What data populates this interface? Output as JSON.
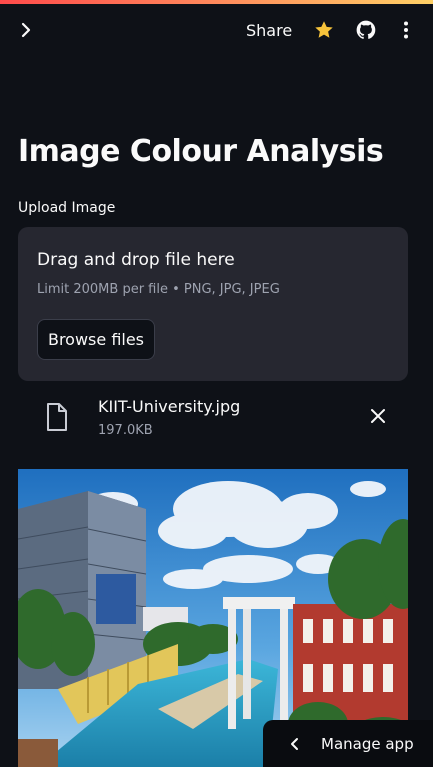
{
  "header": {
    "share_label": "Share",
    "icons": {
      "expand": "chevron-right-icon",
      "star": "star-icon",
      "github": "github-icon",
      "menu": "more-vertical-icon"
    }
  },
  "main": {
    "title": "Image Colour Analysis",
    "upload_label": "Upload Image",
    "dropzone": {
      "title": "Drag and drop file here",
      "limit": "Limit 200MB per file • PNG, JPG, JPEG",
      "browse_label": "Browse files"
    },
    "file": {
      "name": "KIIT-University.jpg",
      "size": "197.0KB"
    }
  },
  "footer": {
    "manage_label": "Manage app"
  },
  "colors": {
    "background": "#0e1117",
    "panel": "#262730",
    "star": "#f6c33b",
    "muted_text": "#9ea3b0"
  }
}
